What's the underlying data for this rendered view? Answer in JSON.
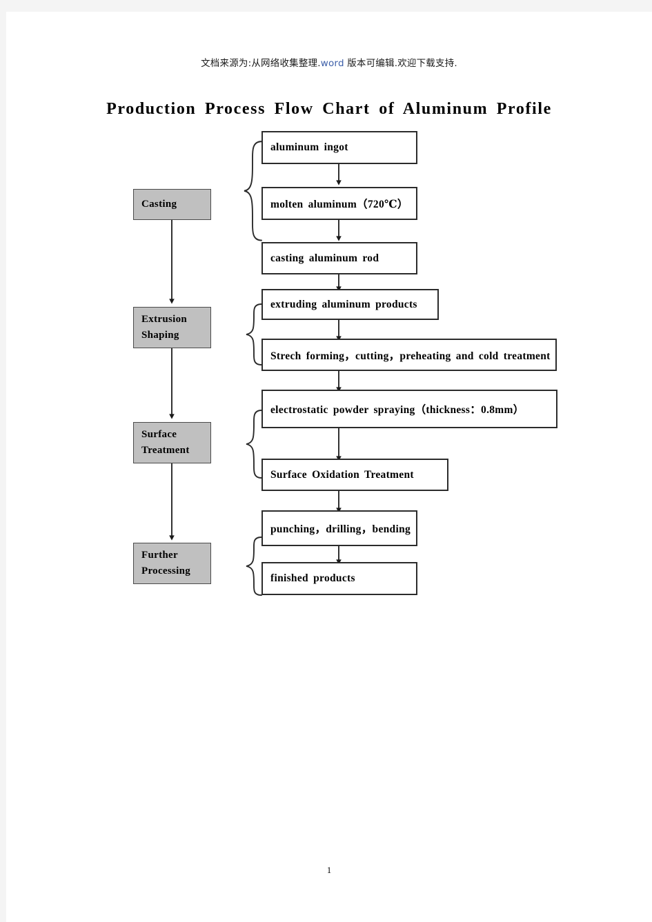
{
  "document": {
    "source_note_cn": "文档来源为:从网络收集整理.",
    "source_note_word": "word",
    "source_note_cn2": " 版本可编辑.欢迎下载支持.",
    "title": "Production Process Flow Chart of Aluminum Profile",
    "page_number": "1"
  },
  "colors": {
    "stage_fill": "#c0c0c0",
    "box_border": "#2b2b2b",
    "page_background": "#ffffff",
    "canvas_background": "#f4f4f4"
  },
  "chart_data": {
    "type": "diagram",
    "title": "Production Process Flow Chart of Aluminum Profile",
    "orientation": "top-to-bottom",
    "stages": [
      {
        "id": "casting",
        "label_lines": [
          "Casting"
        ],
        "steps": [
          "aluminum ingot",
          "molten aluminum（720℃）",
          "casting aluminum rod"
        ]
      },
      {
        "id": "extrusion-shaping",
        "label_lines": [
          "Extrusion",
          "Shaping"
        ],
        "steps": [
          "extruding aluminum products",
          "Strech forming，cutting，preheating and cold treatment"
        ]
      },
      {
        "id": "surface-treatment",
        "label_lines": [
          "Surface",
          "Treatment"
        ],
        "steps": [
          "electrostatic powder spraying（thickness：0.8mm）",
          "Surface Oxidation Treatment"
        ]
      },
      {
        "id": "further-processing",
        "label_lines": [
          "Further",
          "Processing"
        ],
        "steps": [
          "punching，drilling，bending",
          "finished products"
        ]
      }
    ]
  },
  "stages": {
    "casting": {
      "line1": "Casting"
    },
    "extrusion": {
      "line1": "Extrusion",
      "line2": "Shaping"
    },
    "surface": {
      "line1": "Surface",
      "line2": "Treatment"
    },
    "further": {
      "line1": "Further",
      "line2": "Processing"
    }
  },
  "steps": {
    "aluminum_ingot": "aluminum ingot",
    "molten_aluminum": "molten aluminum（720℃）",
    "casting_rod": "casting aluminum rod",
    "extruding": "extruding aluminum products",
    "strech_forming": "Strech forming，cutting，preheating and cold treatment",
    "powder_spraying": "electrostatic powder spraying（thickness：0.8mm）",
    "surface_oxidation": "Surface Oxidation Treatment",
    "punching": "punching，drilling，bending",
    "finished": "finished products"
  }
}
